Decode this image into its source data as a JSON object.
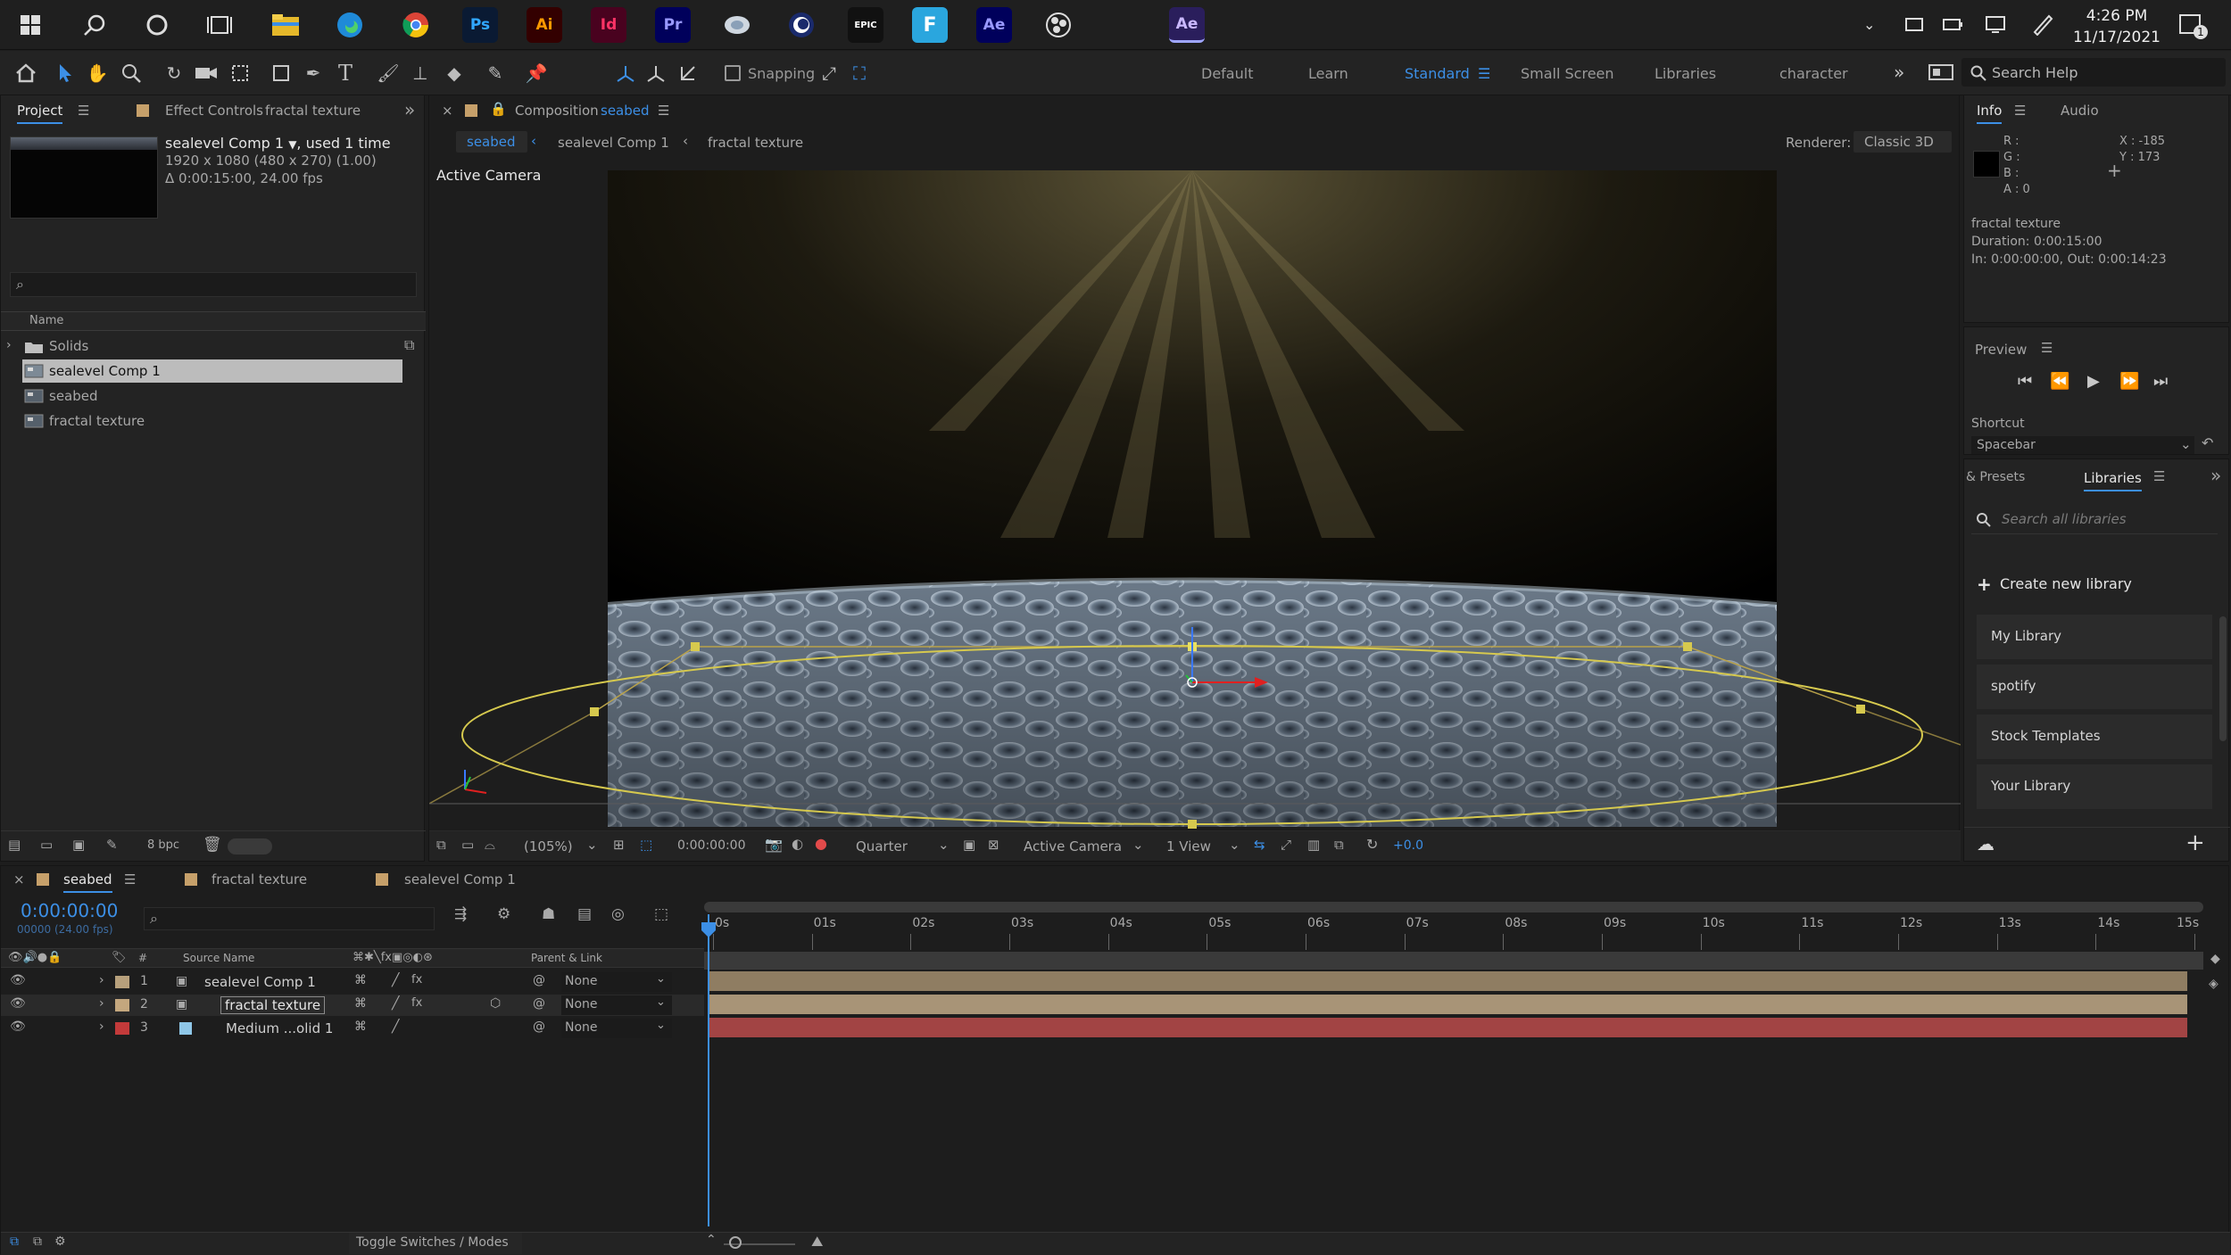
{
  "taskbar": {
    "apps": [
      {
        "label": "Ps",
        "bg": "#0a1a33",
        "fg": "#31a8ff"
      },
      {
        "label": "Ai",
        "bg": "#330000",
        "fg": "#ff9a00"
      },
      {
        "label": "Id",
        "bg": "#49021f",
        "fg": "#ff3366"
      },
      {
        "label": "Pr",
        "bg": "#00005b",
        "fg": "#9999ff"
      },
      {
        "label": "EPIC",
        "bg": "#111111",
        "fg": "#ffffff"
      },
      {
        "label": "F",
        "bg": "#2aa6de",
        "fg": "#ffffff"
      },
      {
        "label": "Ae",
        "bg": "#00005b",
        "fg": "#9999ff"
      },
      {
        "label": "Ae",
        "bg": "#2a1e5c",
        "fg": "#c9b8ff"
      }
    ],
    "time": "4:26 PM",
    "date": "11/17/2021",
    "notif": "1"
  },
  "toolbar": {
    "snapping": "Snapping",
    "workspaces": [
      "Default",
      "Learn",
      "Standard",
      "Small Screen",
      "Libraries",
      "character"
    ],
    "active_ws": "Standard",
    "search": "Search Help"
  },
  "project": {
    "tab": "Project",
    "effect_tab": "Effect Controls",
    "effect_target": "fractal texture",
    "comp_name": "sealevel Comp 1",
    "used": ", used 1 time",
    "dims": "1920 x 1080  (480 x 270) (1.00)",
    "duration": "Δ 0:00:15:00, 24.00 fps",
    "col_name": "Name",
    "items": [
      {
        "name": "Solids",
        "type": "folder"
      },
      {
        "name": "sealevel Comp 1",
        "type": "comp",
        "selected": true
      },
      {
        "name": "seabed",
        "type": "comp"
      },
      {
        "name": "fractal texture",
        "type": "comp"
      }
    ],
    "bpc": "8 bpc"
  },
  "comp": {
    "prefix": "Composition",
    "name": "seabed",
    "crumbs": [
      "seabed",
      "sealevel Comp 1",
      "fractal texture"
    ],
    "renderer_label": "Renderer:",
    "renderer": "Classic 3D",
    "view_label": "Active Camera",
    "zoom": "(105%)",
    "timecode": "0:00:00:00",
    "resolution": "Quarter",
    "camera": "Active Camera",
    "views": "1 View",
    "exposure": "+0.0"
  },
  "info": {
    "tabs": [
      "Info",
      "Audio"
    ],
    "r": "R :",
    "g": "G :",
    "b": "B :",
    "a": "A :  0",
    "x": "X : -185",
    "y": "Y : 173",
    "layer": "fractal texture",
    "duration": "Duration: 0:00:15:00",
    "inout": "In: 0:00:00:00, Out: 0:00:14:23"
  },
  "preview": {
    "title": "Preview",
    "shortcut_label": "Shortcut",
    "shortcut": "Spacebar"
  },
  "libraries": {
    "tabs": [
      "& Presets",
      "Libraries"
    ],
    "search": "Search all libraries",
    "create": "Create new library",
    "items": [
      "My Library",
      "spotify",
      "Stock Templates",
      "Your Library"
    ]
  },
  "timeline": {
    "tabs": [
      "seabed",
      "fractal texture",
      "sealevel Comp 1"
    ],
    "timecode": "0:00:00:00",
    "frames": "00000 (24.00 fps)",
    "col_source": "Source Name",
    "col_parent": "Parent & Link",
    "col_num": "#",
    "layers": [
      {
        "num": "1",
        "name": "sealevel Comp 1",
        "parent": "None",
        "label": "#b7a07c",
        "bar": "#8f7d62"
      },
      {
        "num": "2",
        "name": "fractal texture",
        "parent": "None",
        "label": "#c4a77e",
        "bar": "#a89477"
      },
      {
        "num": "3",
        "name": "Medium ...olid 1",
        "parent": "None",
        "label": "#c33a3a",
        "bar": "#a24444"
      }
    ],
    "ruler": [
      "0s",
      "01s",
      "02s",
      "03s",
      "04s",
      "05s",
      "06s",
      "07s",
      "08s",
      "09s",
      "10s",
      "11s",
      "12s",
      "13s",
      "14s",
      "15s"
    ],
    "toggle": "Toggle Switches / Modes"
  }
}
